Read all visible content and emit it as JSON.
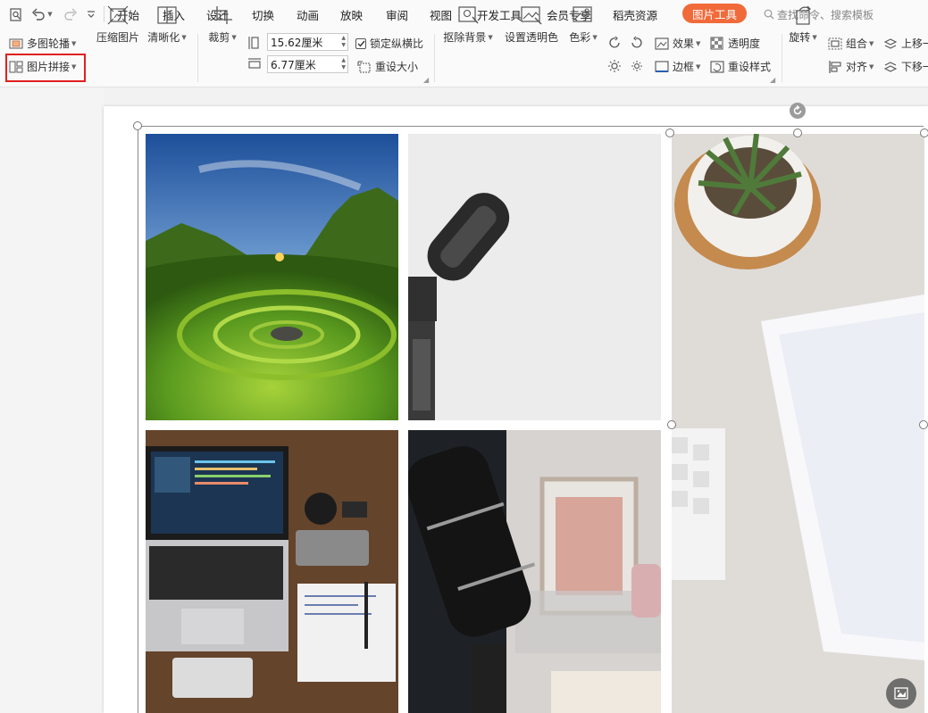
{
  "quick_access": {
    "icons": [
      "print-preview-icon",
      "undo-icon",
      "redo-icon",
      "customize-icon"
    ]
  },
  "tabs": [
    "开始",
    "插入",
    "设计",
    "切换",
    "动画",
    "放映",
    "审阅",
    "视图",
    "开发工具",
    "会员专享",
    "稻壳资源"
  ],
  "active_tab": "图片工具",
  "search": {
    "placeholder": "查找命令、搜索模板"
  },
  "ribbon": {
    "multi_carousel": "多图轮播",
    "picture_stitch": "图片拼接",
    "compress": "压缩图片",
    "sharpen": "清晰化",
    "crop": "裁剪",
    "height_value": "15.62厘米",
    "width_value": "6.77厘米",
    "lock_ratio": "锁定纵横比",
    "reset_size": "重设大小",
    "remove_bg": "抠除背景",
    "set_transparent": "设置透明色",
    "color": "色彩",
    "effects": "效果",
    "transparency": "透明度",
    "border": "边框",
    "reset_style": "重设样式",
    "rotate": "旋转",
    "group": "组合",
    "align": "对齐",
    "bring_forward": "上移一层",
    "send_backward": "下移一层"
  },
  "slide": {
    "pictures": [
      {
        "name": "landscape-photo",
        "subject": "grass spiral landscape at sunset"
      },
      {
        "name": "microphone-photo",
        "subject": "microphone on stand, white background"
      },
      {
        "name": "desk-plant-photo",
        "subject": "succulent plant, paper, keyboard"
      },
      {
        "name": "laptop-desk-photo",
        "subject": "laptop, phone, notebook on wooden desk"
      },
      {
        "name": "studio-mic-photo",
        "subject": "black studio microphone"
      }
    ]
  },
  "colors": {
    "accent": "#f16a3a",
    "highlight_box": "#e02020"
  }
}
